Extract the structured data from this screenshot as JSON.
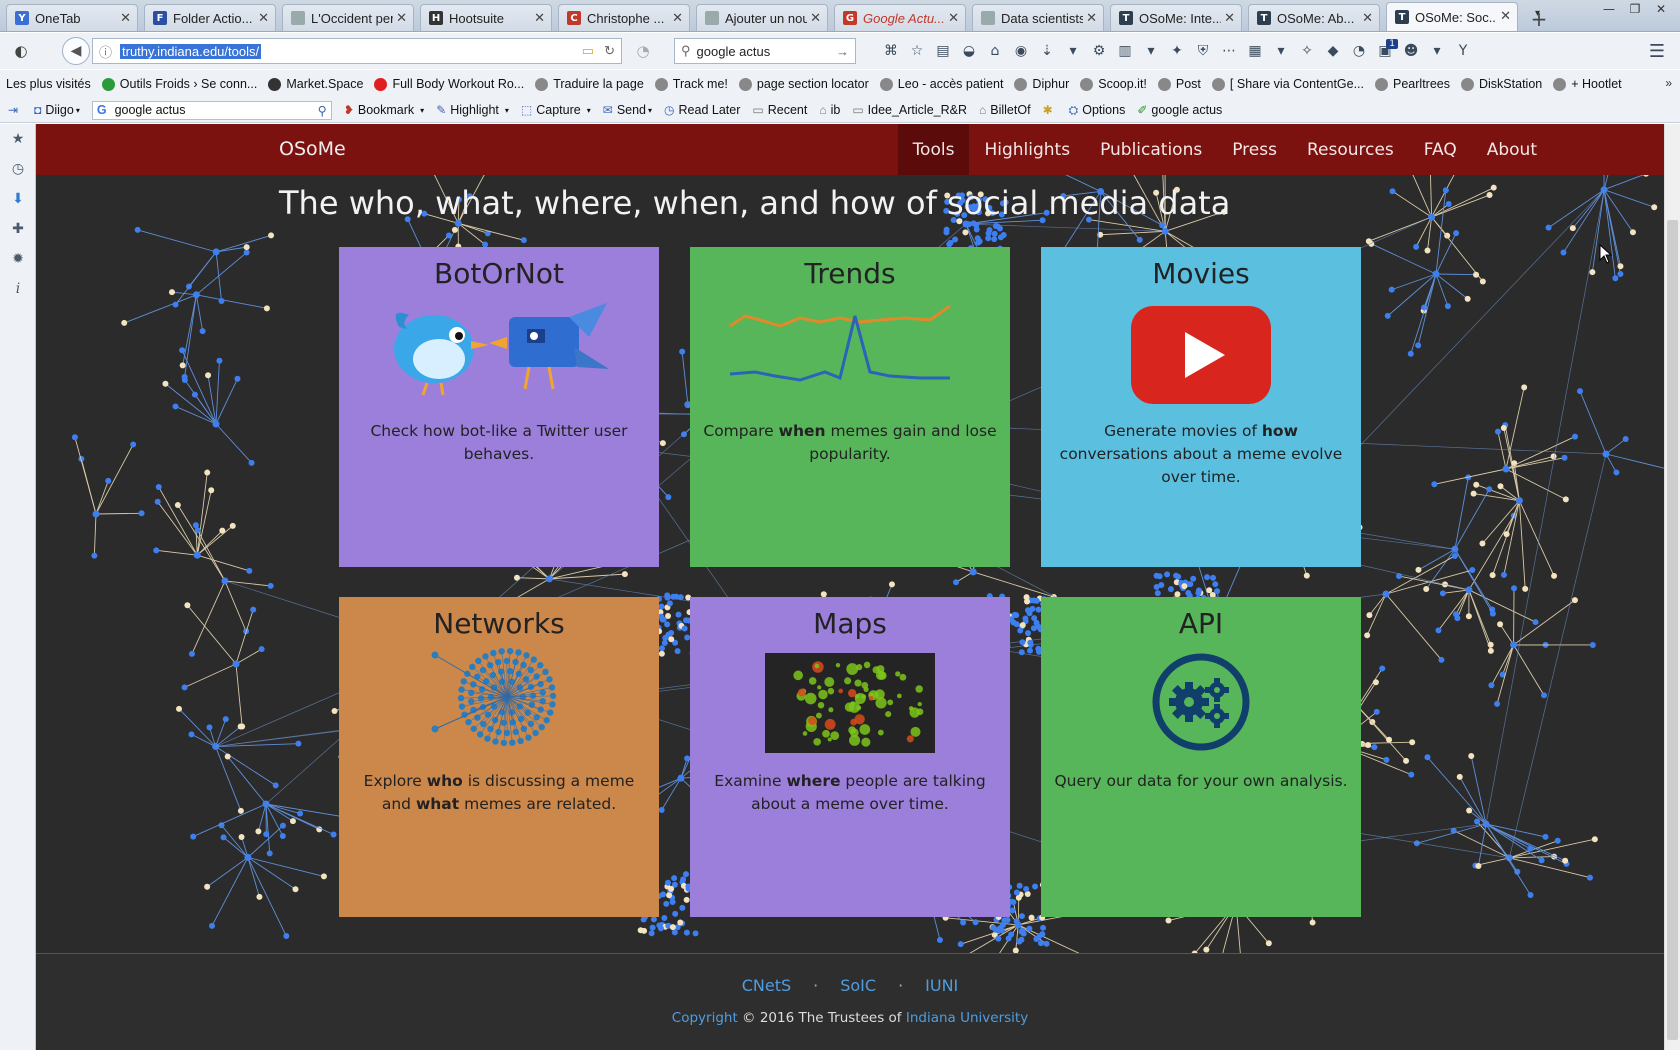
{
  "browser": {
    "tabs": [
      {
        "title": "OneTab",
        "icon_color": "#3b6fd6",
        "icon": "Y"
      },
      {
        "title": "Folder Actio...",
        "icon_color": "#2b4fa3",
        "icon": "F"
      },
      {
        "title": "L'Occident perdr...",
        "icon_color": "#9aa",
        "icon": ""
      },
      {
        "title": "Hootsuite",
        "icon_color": "#333",
        "icon": "H"
      },
      {
        "title": "Christophe ...",
        "icon_color": "#c0392b",
        "icon": "C"
      },
      {
        "title": "Ajouter un nouv...",
        "icon_color": "#9aa",
        "icon": ""
      },
      {
        "title": "Google Actu...",
        "icon_color": "#c0392b",
        "icon": "G"
      },
      {
        "title": "Data scientists la...",
        "icon_color": "#9aa",
        "icon": ""
      },
      {
        "title": "OSoMe: Inte...",
        "icon_color": "#2c3e50",
        "icon": "T"
      },
      {
        "title": "OSoMe: Ab...",
        "icon_color": "#2c3e50",
        "icon": "T"
      },
      {
        "title": "OSoMe: Soc...",
        "icon_color": "#2c3e50",
        "icon": "T"
      }
    ],
    "active_tab_index": 10,
    "url": "truthy.indiana.edu/tools/",
    "search_query": "google actus",
    "bookmarks": [
      "Les plus visités",
      "Outils Froids › Se conn...",
      "Market.Space",
      "Full Body Workout Ro...",
      "Traduire la page",
      "Track me!",
      "page section locator",
      "Leo - accès patient",
      "Diphur",
      "Scoop.it!",
      "Post",
      "[ Share via ContentGe...",
      "Pearltrees",
      "DiskStation",
      "+ Hootlet"
    ],
    "diigo": {
      "diigo_label": "Diigo",
      "search_value": "google actus",
      "bookmark": "Bookmark",
      "highlight": "Highlight",
      "capture": "Capture",
      "send": "Send",
      "read_later": "Read Later",
      "recent": "Recent",
      "ib": "ib",
      "folder": "Idee_Article_R&R",
      "billetof": "BilletOf",
      "options": "Options",
      "search_text": "google  actus"
    },
    "badge_count": "1"
  },
  "site": {
    "brand": "OSoMe",
    "menu": [
      {
        "label": "Tools",
        "active": true
      },
      {
        "label": "Highlights",
        "active": false
      },
      {
        "label": "Publications",
        "active": false
      },
      {
        "label": "Press",
        "active": false
      },
      {
        "label": "Resources",
        "active": false
      },
      {
        "label": "FAQ",
        "active": false
      },
      {
        "label": "About",
        "active": false
      }
    ],
    "headline": "The who, what, where, when, and how of social media data",
    "cards": [
      {
        "title": "BotOrNot",
        "color": "#9b7fdb",
        "desc_pre": "Check how bot-like a Twitter user behaves.",
        "desc_bold": "",
        "desc_post": ""
      },
      {
        "title": "Trends",
        "color": "#57b55a",
        "desc_pre": "Compare ",
        "desc_bold": "when",
        "desc_post": " memes gain and lose popularity."
      },
      {
        "title": "Movies",
        "color": "#5bbfe0",
        "desc_pre": "Generate movies of ",
        "desc_bold": "how",
        "desc_post": " conversations about a meme evolve over time."
      },
      {
        "title": "Networks",
        "color": "#cc874a",
        "desc_pre": "Explore ",
        "desc_bold": "who",
        "desc_post": " is discussing a meme and ",
        "desc_bold2": "what",
        "desc_post2": " memes are related."
      },
      {
        "title": "Maps",
        "color": "#9b7fdb",
        "desc_pre": "Examine ",
        "desc_bold": "where",
        "desc_post": " people are talking about a meme over time."
      },
      {
        "title": "API",
        "color": "#57b55a",
        "desc_pre": "Query our data for your own analysis.",
        "desc_bold": "",
        "desc_post": ""
      }
    ],
    "footer": {
      "links": [
        "CNetS",
        "SoIC",
        "IUNI"
      ],
      "separator": "·",
      "copyright_link": "Copyright",
      "copyright_text": " © 2016 The Trustees of ",
      "university": "Indiana University"
    }
  },
  "colors": {
    "nav_bg": "#7b1210",
    "nav_active": "#5b0c0a",
    "page_bg": "#2b2b2b",
    "link": "#4f9de0",
    "node_blue": "#3e7ff0",
    "node_cream": "#f3e3bf"
  }
}
